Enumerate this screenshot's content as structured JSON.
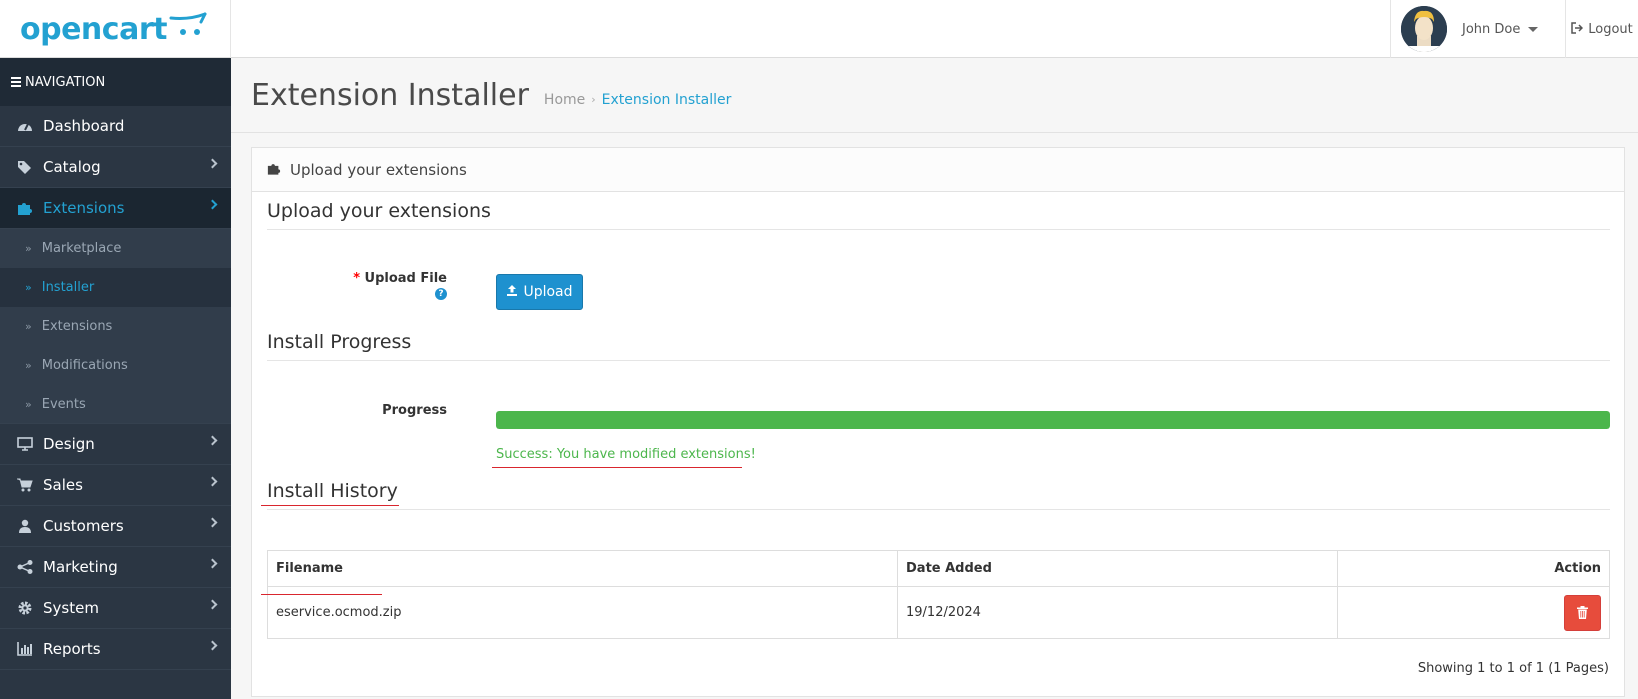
{
  "header": {
    "logo_text": "opencart",
    "user_name": "John Doe",
    "logout_label": "Logout"
  },
  "sidebar": {
    "title": "NAVIGATION",
    "items": [
      {
        "label": "Dashboard",
        "icon": "dashboard-icon"
      },
      {
        "label": "Catalog",
        "icon": "tags-icon"
      },
      {
        "label": "Extensions",
        "icon": "puzzle-icon"
      },
      {
        "label": "Design",
        "icon": "monitor-icon"
      },
      {
        "label": "Sales",
        "icon": "cart-icon"
      },
      {
        "label": "Customers",
        "icon": "user-icon"
      },
      {
        "label": "Marketing",
        "icon": "share-icon"
      },
      {
        "label": "System",
        "icon": "gear-icon"
      },
      {
        "label": "Reports",
        "icon": "bar-chart-icon"
      }
    ],
    "extensions_sub": [
      {
        "label": "Marketplace"
      },
      {
        "label": "Installer"
      },
      {
        "label": "Extensions"
      },
      {
        "label": "Modifications"
      },
      {
        "label": "Events"
      }
    ]
  },
  "page": {
    "title": "Extension Installer",
    "breadcrumb": [
      "Home",
      "Extension Installer"
    ]
  },
  "panel": {
    "heading": "Upload your extensions",
    "upload_section_title": "Upload your extensions",
    "upload_label": "Upload File",
    "upload_required_mark": "*",
    "upload_button": "Upload",
    "progress_section_title": "Install Progress",
    "progress_label": "Progress",
    "progress_value": 1.0,
    "success_message": "Success: You have modified extensions!",
    "history_section_title": "Install History",
    "table": {
      "columns": [
        "Filename",
        "Date Added",
        "Action"
      ],
      "rows": [
        {
          "filename": "eservice.ocmod.zip",
          "date_added": "19/12/2024"
        }
      ]
    },
    "pager_text": "Showing 1 to 1 of 1 (1 Pages)"
  },
  "colors": {
    "accent": "#23a1d1",
    "sidebar_bg": "#2b3643",
    "success": "#4cb64c",
    "danger": "#e74c3c",
    "annotation": "#d9262e"
  }
}
